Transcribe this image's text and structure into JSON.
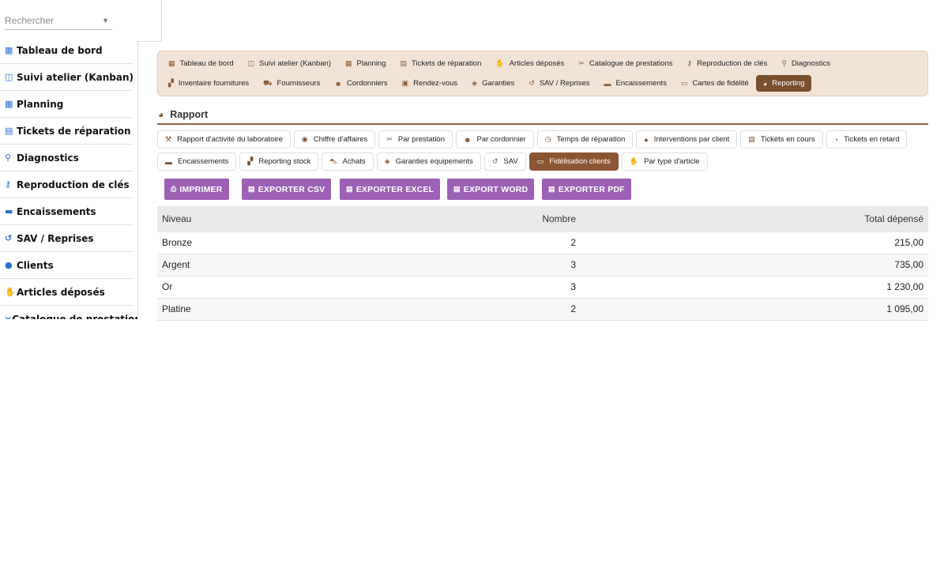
{
  "sidebar": {
    "search_placeholder": "Rechercher",
    "items": [
      {
        "label": "Tableau de bord",
        "icon": "grid-icon"
      },
      {
        "label": "Suivi atelier (Kanban)",
        "icon": "columns-icon"
      },
      {
        "label": "Planning",
        "icon": "calendar-icon"
      },
      {
        "label": "Tickets de réparation",
        "icon": "receipt-icon"
      },
      {
        "label": "Diagnostics",
        "icon": "search-icon"
      },
      {
        "label": "Reproduction de clés",
        "icon": "key-icon"
      },
      {
        "label": "Encaissements",
        "icon": "money-icon"
      },
      {
        "label": "SAV / Reprises",
        "icon": "undo-icon"
      },
      {
        "label": "Clients",
        "icon": "user-icon"
      },
      {
        "label": "Articles déposés",
        "icon": "hand-icon"
      },
      {
        "label": "Catalogue de prestations",
        "icon": "tools-icon"
      }
    ]
  },
  "topnav": {
    "row1": [
      {
        "label": "Tableau de bord",
        "icon": "grid-icon"
      },
      {
        "label": "Suivi atelier (Kanban)",
        "icon": "columns-icon"
      },
      {
        "label": "Planning",
        "icon": "calendar-icon"
      },
      {
        "label": "Tickets de réparation",
        "icon": "receipt-icon"
      },
      {
        "label": "Articles déposés",
        "icon": "hand-icon"
      },
      {
        "label": "Catalogue de prestations",
        "icon": "tools-icon"
      },
      {
        "label": "Reproduction de clés",
        "icon": "key-icon"
      },
      {
        "label": "Diagnostics",
        "icon": "search-icon"
      }
    ],
    "row2": [
      {
        "label": "Inventaire fournitures",
        "icon": "boxes-icon"
      },
      {
        "label": "Fournisseurs",
        "icon": "truck-icon"
      },
      {
        "label": "Cordonniers",
        "icon": "user-gear-icon"
      },
      {
        "label": "Rendez-vous",
        "icon": "calendar-check-icon"
      },
      {
        "label": "Garanties",
        "icon": "shield-icon"
      },
      {
        "label": "SAV / Reprises",
        "icon": "undo-icon"
      },
      {
        "label": "Encaissements",
        "icon": "money-icon"
      },
      {
        "label": "Cartes de fidélité",
        "icon": "id-card-icon"
      },
      {
        "label": "Reporting",
        "icon": "chart-pie-icon",
        "active": true
      }
    ]
  },
  "section": {
    "title": "Rapport",
    "icon": "chart-pie-icon"
  },
  "report_tabs": {
    "row1": [
      {
        "label": "Rapport d'activité du laboratoire",
        "icon": "hammer-icon"
      },
      {
        "label": "Chiffre d'affaires",
        "icon": "coins-icon"
      },
      {
        "label": "Par prestation",
        "icon": "tools-icon"
      },
      {
        "label": "Par cordonnier",
        "icon": "user-gear-icon"
      },
      {
        "label": "Temps de réparation",
        "icon": "stopwatch-icon"
      },
      {
        "label": "Interventions par client",
        "icon": "user-icon"
      },
      {
        "label": "Tickets en cours",
        "icon": "receipt-icon"
      },
      {
        "label": "Tickets en retard",
        "icon": "clock-icon"
      }
    ],
    "row2": [
      {
        "label": "Encaissements",
        "icon": "money-icon"
      },
      {
        "label": "Reporting stock",
        "icon": "boxes-icon"
      },
      {
        "label": "Achats",
        "icon": "cart-icon"
      },
      {
        "label": "Garanties equipements",
        "icon": "shield-icon"
      },
      {
        "label": "SAV",
        "icon": "undo-icon"
      },
      {
        "label": "Fidélisation clients",
        "icon": "id-card-icon",
        "active": true
      },
      {
        "label": "Par type d'article",
        "icon": "hand-icon"
      }
    ]
  },
  "export_buttons": [
    {
      "label": "IMPRIMER",
      "icon": "print-icon"
    },
    {
      "label": "EXPORTER CSV",
      "icon": "file-csv-icon"
    },
    {
      "label": "EXPORTER EXCEL",
      "icon": "file-excel-icon"
    },
    {
      "label": "EXPORT WORD",
      "icon": "file-word-icon"
    },
    {
      "label": "EXPORTER PDF",
      "icon": "file-pdf-icon"
    }
  ],
  "table": {
    "headers": [
      "Niveau",
      "Nombre",
      "Total dépensé"
    ],
    "rows": [
      [
        "Bronze",
        "2",
        "215,00"
      ],
      [
        "Argent",
        "3",
        "735,00"
      ],
      [
        "Or",
        "3",
        "1 230,00"
      ],
      [
        "Platine",
        "2",
        "1 095,00"
      ]
    ]
  },
  "colors": {
    "accent_brown": "#7a4f2c",
    "nav_bg": "#f1e4d7",
    "button_purple": "#9c61b5",
    "sidebar_icon_blue": "#2f6fd3"
  }
}
